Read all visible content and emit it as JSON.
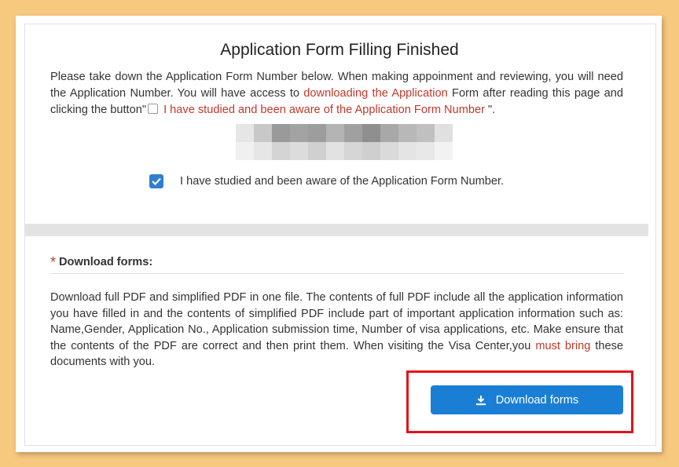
{
  "page": {
    "title": "Application Form Filling Finished",
    "intro_part1": "Please take down the Application Form Number below. When making appoinment and reviewing, you will need the Application Number. You will have access to ",
    "intro_link": "downloading the Application",
    "intro_part2": " Form after reading this page and clicking the button\"",
    "intro_quote_label": " I have studied and been aware of the Application Form Number",
    "intro_part3": " \".",
    "acknowledge_label": "I have studied and been aware of the Application Form Number.",
    "acknowledge_checked": true
  },
  "download_section": {
    "required_mark": "*",
    "heading": "Download forms:",
    "desc_part1": "Download full PDF and simplified PDF in one file. The contents of full PDF include all the application information you have filled in and the contents of simplified PDF include part of important application information such as: Name,Gender, Application No., Application submission time, Number of visa applications, etc. Make ensure that the contents of the PDF are correct and then print them. When visiting the Visa Center,you ",
    "desc_emphasis": "must bring",
    "desc_part2": " these documents with you.",
    "button_label": "Download forms"
  },
  "colors": {
    "background": "#f7c97f",
    "accent_blue": "#1a7fd4",
    "red_text": "#c0392b",
    "highlight_red": "#e5101a"
  },
  "icons": {
    "checkbox": "checkmark-icon",
    "download": "download-icon"
  }
}
